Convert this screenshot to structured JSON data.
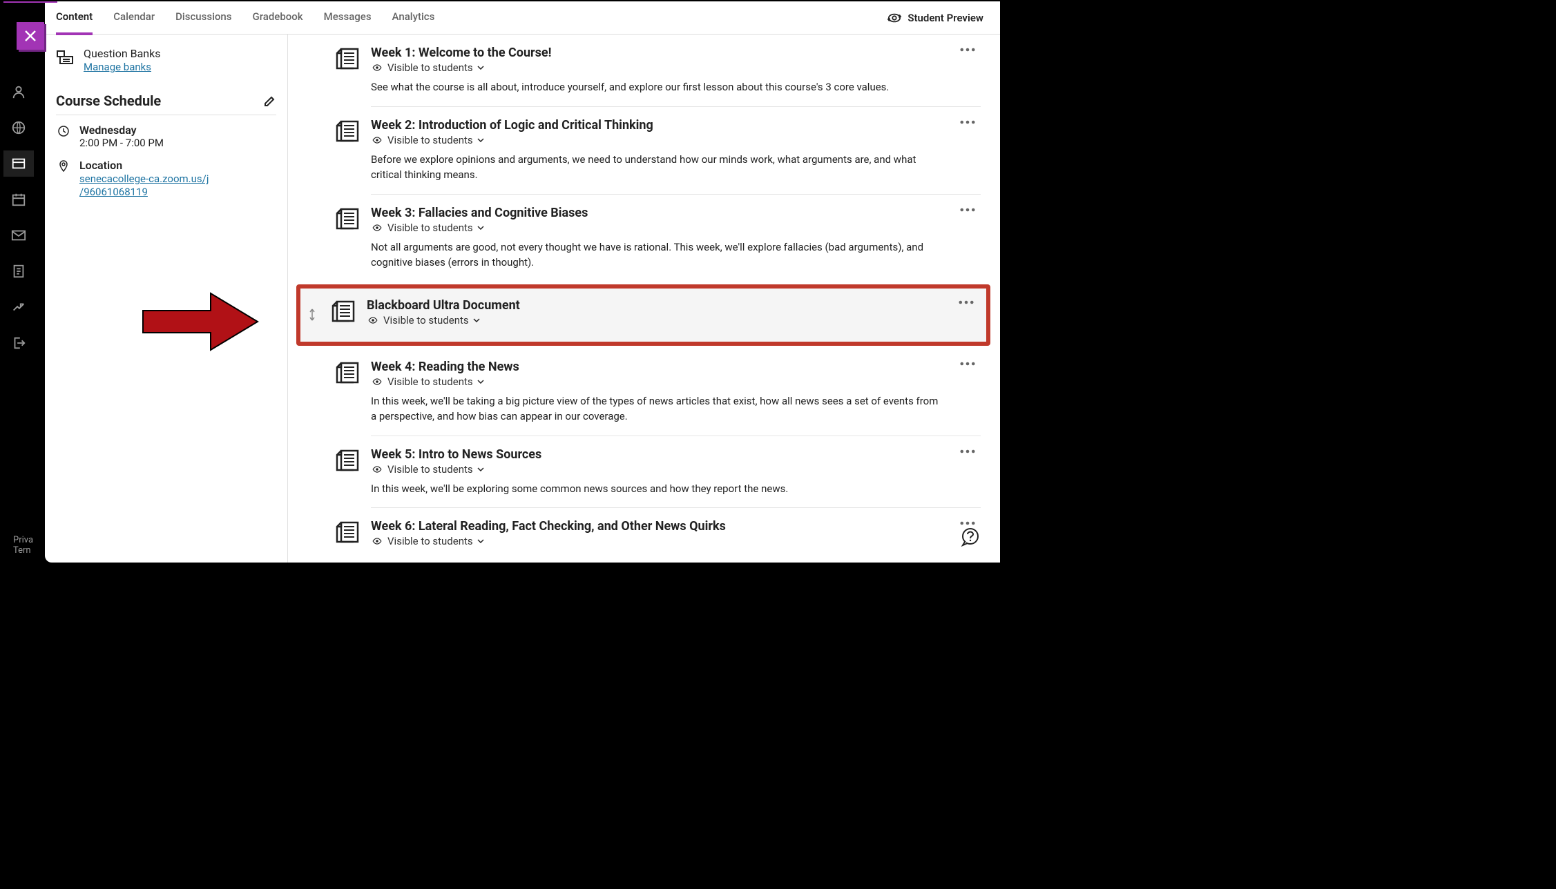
{
  "topnav": {
    "tabs": [
      "Content",
      "Calendar",
      "Discussions",
      "Gradebook",
      "Messages",
      "Analytics"
    ],
    "active_tab": 0,
    "student_preview": "Student Preview"
  },
  "sidebar": {
    "question_banks": {
      "title": "Question Banks",
      "link_text": "Manage banks"
    },
    "schedule": {
      "header": "Course Schedule",
      "day": "Wednesday",
      "time": "2:00 PM - 7:00 PM",
      "location_label": "Location",
      "location_url_line1": "senecacollege-ca.zoom.us/j",
      "location_url_line2": "/96061068119"
    }
  },
  "footer": {
    "line1": "Priva",
    "line2": "Tern"
  },
  "content_items": [
    {
      "title": "Week 1: Welcome to the Course!",
      "visibility": "Visible to students",
      "description": "See what the course is all about, introduce yourself, and explore our first lesson about this course's 3 core values.",
      "highlighted": false
    },
    {
      "title": "Week 2: Introduction of Logic and Critical Thinking",
      "visibility": "Visible to students",
      "description": "Before we explore opinions and arguments, we need to understand how our minds work, what arguments are, and what critical thinking means.",
      "highlighted": false
    },
    {
      "title": "Week 3: Fallacies and Cognitive Biases",
      "visibility": "Visible to students",
      "description": "Not all arguments are good, not every thought we have is rational. This week, we'll explore fallacies (bad arguments), and cognitive biases (errors in thought).",
      "highlighted": false
    },
    {
      "title": "Blackboard Ultra Document",
      "visibility": "Visible to students",
      "description": "",
      "highlighted": true
    },
    {
      "title": "Week 4: Reading the News",
      "visibility": "Visible to students",
      "description": "In this week, we'll be taking a big picture view of the types of news articles that exist, how all news sees a set of events from a perspective, and how bias can appear in our coverage.",
      "highlighted": false
    },
    {
      "title": "Week 5: Intro to News Sources",
      "visibility": "Visible to students",
      "description": "In this week, we'll be exploring some common news sources and how they report the news.",
      "highlighted": false
    },
    {
      "title": "Week 6: Lateral Reading, Fact Checking, and Other News Quirks",
      "visibility": "Visible to students",
      "description": "",
      "highlighted": false
    }
  ]
}
